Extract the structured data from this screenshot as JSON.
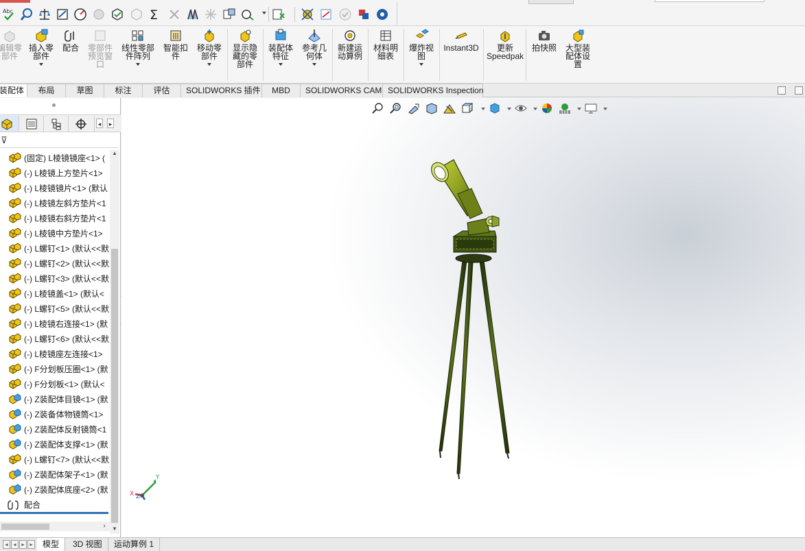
{
  "ribbon": {
    "buttons": [
      {
        "id": "edit-component",
        "label": "编辑零\n部件",
        "disabled": true
      },
      {
        "id": "insert-component",
        "label": "插入零\n部件",
        "disabled": false
      },
      {
        "id": "mate",
        "label": "配合",
        "disabled": false
      },
      {
        "id": "component-preview",
        "label": "零部件\n预览窗\n口",
        "disabled": true
      },
      {
        "id": "linear-pattern",
        "label": "线性零部\n件阵列",
        "disabled": false
      },
      {
        "id": "smart-fasteners",
        "label": "智能扣\n件",
        "disabled": false
      },
      {
        "id": "move-component",
        "label": "移动零\n部件",
        "disabled": false
      },
      {
        "id": "show-hidden",
        "label": "显示隐\n藏的零\n部件",
        "disabled": false
      },
      {
        "id": "assembly-features",
        "label": "装配体\n特征",
        "disabled": false
      },
      {
        "id": "reference-geometry",
        "label": "参考几\n何体",
        "disabled": false
      },
      {
        "id": "new-motion-study",
        "label": "新建运\n动算例",
        "disabled": false
      },
      {
        "id": "bill-of-materials",
        "label": "材料明\n细表",
        "disabled": false
      },
      {
        "id": "exploded-view",
        "label": "爆炸视\n图",
        "disabled": false
      },
      {
        "id": "instant3d",
        "label": "Instant3D",
        "disabled": false
      },
      {
        "id": "update-speedpak",
        "label": "更新\nSpeedpak",
        "disabled": false
      },
      {
        "id": "snapshot",
        "label": "拍快照",
        "disabled": false
      },
      {
        "id": "large-assembly",
        "label": "大型装\n配体设\n置",
        "disabled": false
      }
    ]
  },
  "tabs": [
    {
      "label": "装配体",
      "active": true
    },
    {
      "label": "布局",
      "active": false
    },
    {
      "label": "草图",
      "active": false
    },
    {
      "label": "标注",
      "active": false
    },
    {
      "label": "评估",
      "active": false
    },
    {
      "label": "SOLIDWORKS 插件",
      "active": false
    },
    {
      "label": "MBD",
      "active": false
    },
    {
      "label": "SOLIDWORKS CAM",
      "active": false
    },
    {
      "label": "SOLIDWORKS Inspection",
      "active": false
    }
  ],
  "tree": {
    "items": [
      {
        "label": "(固定) L棱镜镜座<1> (",
        "type": "part"
      },
      {
        "label": "(-) L棱镜上方垫片<1>",
        "type": "part"
      },
      {
        "label": "(-) L棱镜镜片<1> (默认",
        "type": "part"
      },
      {
        "label": "(-) L棱镜左斜方垫片<1",
        "type": "part"
      },
      {
        "label": "(-) L棱镜右斜方垫片<1",
        "type": "part"
      },
      {
        "label": "(-) L棱镜中方垫片<1>",
        "type": "part"
      },
      {
        "label": "(-) L螺钉<1> (默认<<默",
        "type": "part"
      },
      {
        "label": "(-) L螺钉<2> (默认<<默",
        "type": "part"
      },
      {
        "label": "(-) L螺钉<3> (默认<<默",
        "type": "part"
      },
      {
        "label": "(-) L棱镜盖<1> (默认<",
        "type": "part"
      },
      {
        "label": "(-) L螺钉<5> (默认<<默",
        "type": "part"
      },
      {
        "label": "(-) L棱镜右连接<1> (默",
        "type": "part"
      },
      {
        "label": "(-) L螺钉<6> (默认<<默",
        "type": "part"
      },
      {
        "label": "(-) L棱镜座左连接<1>",
        "type": "part"
      },
      {
        "label": "(-) F分划板压圈<1> (默",
        "type": "part"
      },
      {
        "label": "(-) F分划板<1> (默认<",
        "type": "part"
      },
      {
        "label": "(-) Z装配体目镜<1> (默",
        "type": "assembly"
      },
      {
        "label": "(-) Z装备体物镜筒<1>",
        "type": "assembly"
      },
      {
        "label": "(-) Z装配体反射镜筒<1",
        "type": "assembly"
      },
      {
        "label": "(-) Z装配体支撑<1> (默",
        "type": "assembly"
      },
      {
        "label": "(-) L螺钉<7> (默认<<默",
        "type": "part"
      },
      {
        "label": "(-) Z装配体架子<1> (默",
        "type": "assembly"
      },
      {
        "label": "(-) Z装配体底座<2> (默",
        "type": "assembly"
      },
      {
        "label": "配合",
        "type": "mates"
      }
    ]
  },
  "triad": {
    "x_label": "X",
    "y_label": "Y",
    "z_label": "Z"
  },
  "bottom_tabs": [
    {
      "label": "模型",
      "active": true
    },
    {
      "label": "3D 视图",
      "active": false
    },
    {
      "label": "运动算例 1",
      "active": false
    }
  ],
  "colors": {
    "accent": "#2f6fb5",
    "part_icon": "#f0c419",
    "assembly_icon": "#46a0dc",
    "model_olive": "#7d8f1e",
    "model_dark": "#22300f"
  }
}
